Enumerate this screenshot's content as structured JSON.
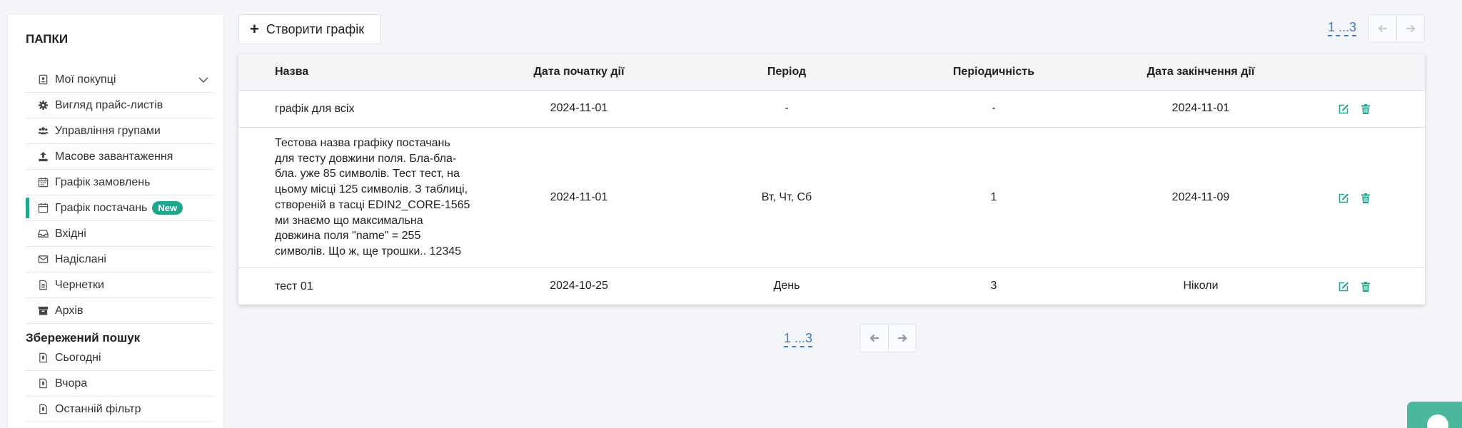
{
  "sidebar": {
    "folders_title": "ПАПКИ",
    "items": [
      {
        "label": "Мої покупці",
        "icon": "user-badge-icon"
      },
      {
        "label": "Вигляд прайс-листів",
        "icon": "gear-icon"
      },
      {
        "label": "Управління групами",
        "icon": "users-icon"
      },
      {
        "label": "Масове завантаження",
        "icon": "upload-icon"
      },
      {
        "label": "Графік замовлень",
        "icon": "calendar-icon"
      },
      {
        "label": "Графік постачань",
        "icon": "calendar-icon",
        "badge": "New",
        "active": true
      },
      {
        "label": "Вхідні",
        "icon": "inbox-icon"
      },
      {
        "label": "Надіслані",
        "icon": "envelope-icon"
      },
      {
        "label": "Чернетки",
        "icon": "document-icon"
      },
      {
        "label": "Архів",
        "icon": "archive-icon"
      }
    ],
    "saved_title": "Збережений пошук",
    "saved_items": [
      {
        "label": "Сьогодні",
        "icon": "saved-file-icon"
      },
      {
        "label": "Вчора",
        "icon": "saved-file-icon"
      },
      {
        "label": "Останній фільтр",
        "icon": "saved-file-icon"
      }
    ]
  },
  "toolbar": {
    "create_label": "Створити графік",
    "pager_text": "1 ...3"
  },
  "table": {
    "headers": [
      "Назва",
      "Дата початку дії",
      "Період",
      "Періодичність",
      "Дата закінчення дії"
    ],
    "rows": [
      {
        "name_lines": [
          "графік для всіх"
        ],
        "start": "2024-11-01",
        "period": "-",
        "frequency": "-",
        "end": "2024-11-01"
      },
      {
        "name_lines": [
          "Тестова назва графіку постачань",
          "для тесту довжини поля. Бла-бла-",
          "бла. уже 85 символів. Тест тест, на",
          "цьому місці 125 символів. З таблиці,",
          "створеній в тасці EDIN2_CORE-1565",
          "ми знаємо що максимальна",
          "довжина поля \"name\" = 255",
          "символів. Що ж, ще трошки.. 12345"
        ],
        "start": "2024-11-01",
        "period": "Вт, Чт, Сб",
        "frequency": "1",
        "end": "2024-11-09"
      },
      {
        "name_lines": [
          "тест 01"
        ],
        "start": "2024-10-25",
        "period": "День",
        "frequency": "3",
        "end": "Ніколи"
      }
    ]
  },
  "bottom_pager": {
    "text": "1 ...3"
  },
  "colors": {
    "accent": "#1fa68d",
    "link": "#3f7cc7",
    "chat": "#4bb89e"
  }
}
